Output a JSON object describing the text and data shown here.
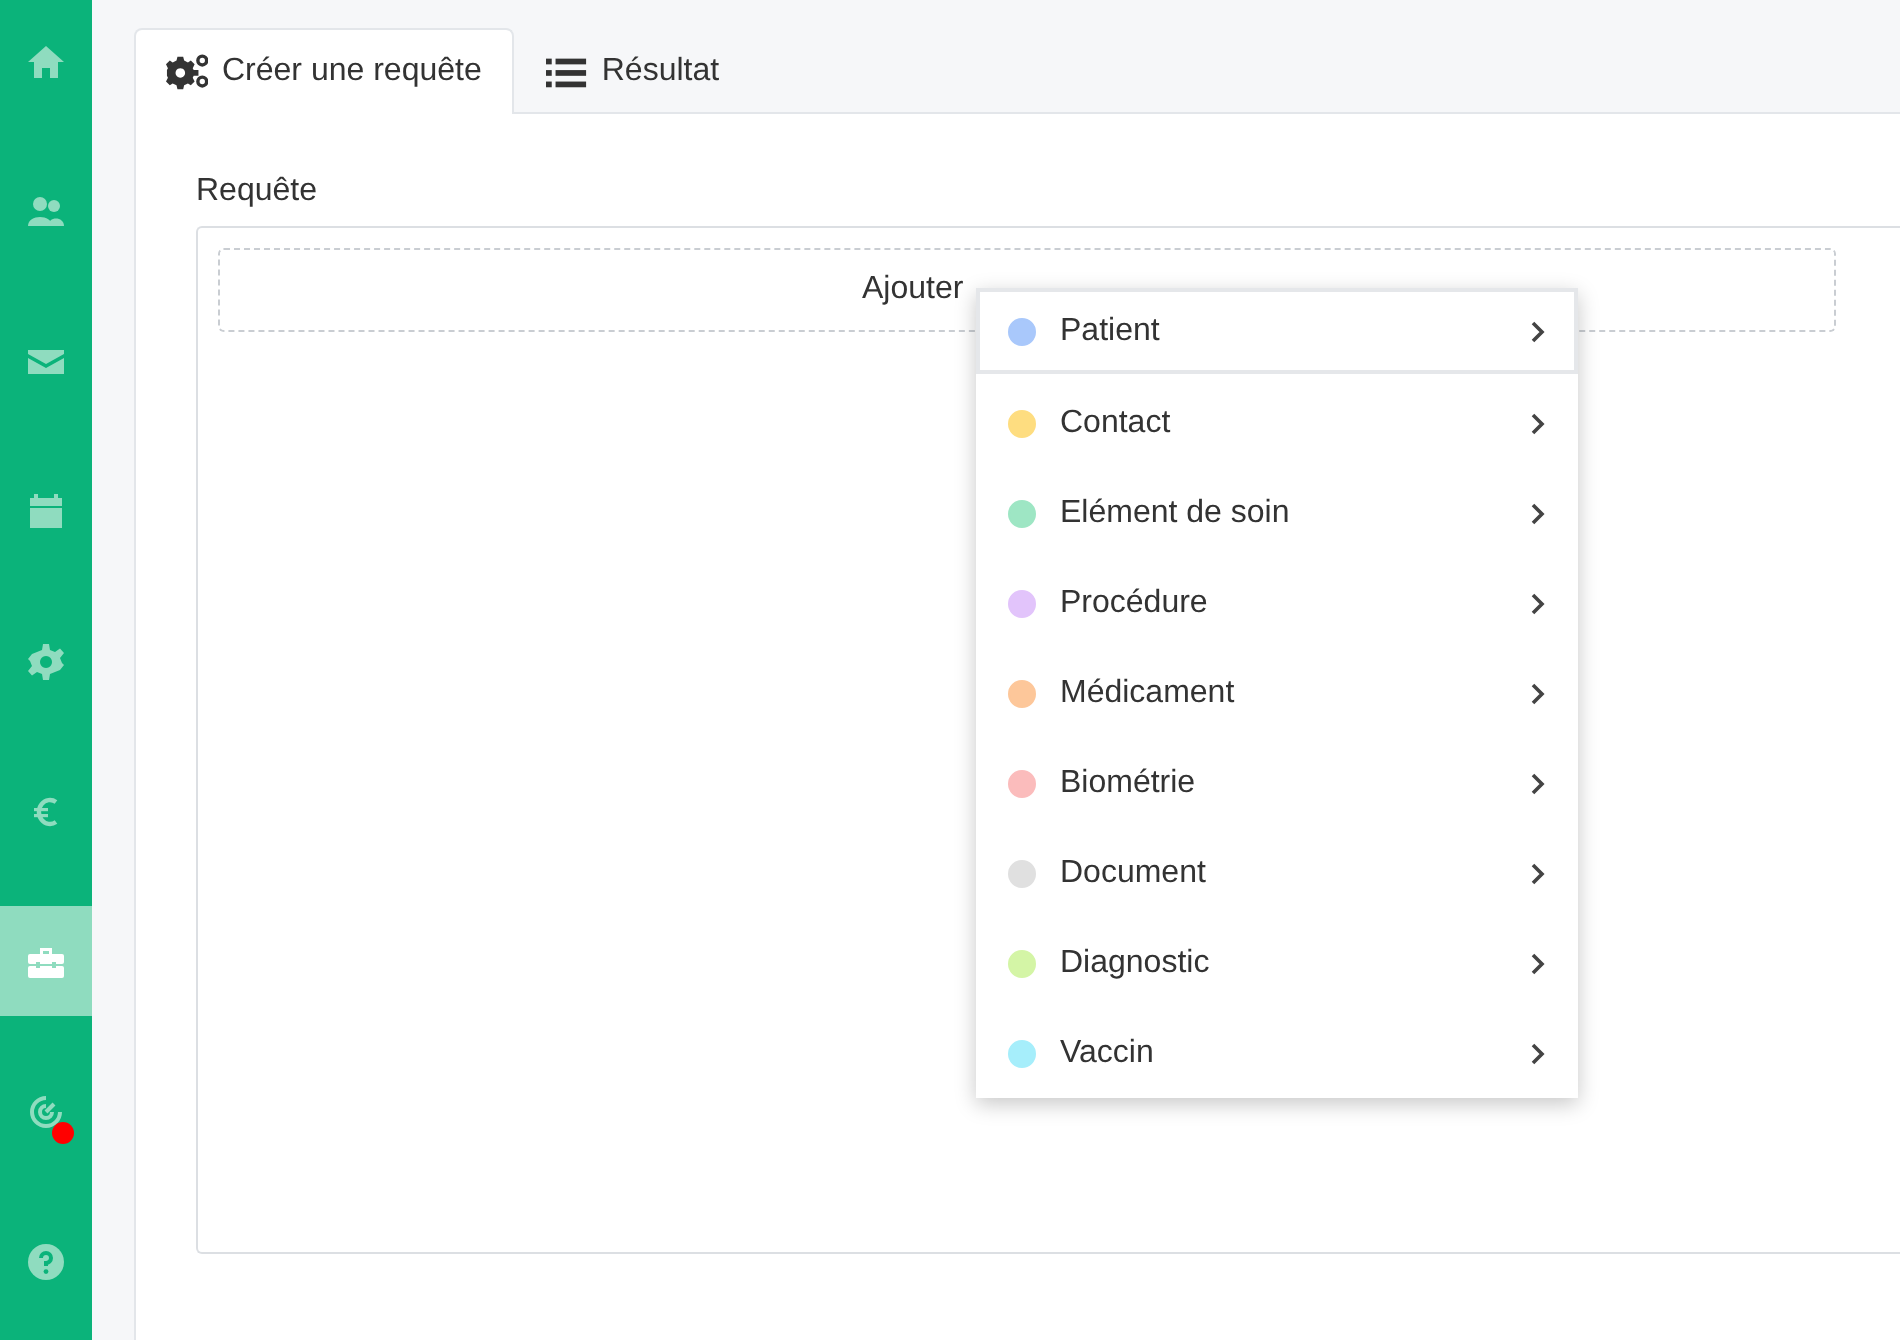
{
  "sidebar": {
    "items": [
      {
        "selected": false,
        "badge": false
      },
      {
        "selected": false,
        "badge": false
      },
      {
        "selected": false,
        "badge": false
      },
      {
        "selected": false,
        "badge": false
      },
      {
        "selected": false,
        "badge": false
      },
      {
        "selected": false,
        "badge": false
      },
      {
        "selected": true,
        "badge": false
      },
      {
        "selected": false,
        "badge": true
      },
      {
        "selected": false,
        "badge": false
      }
    ]
  },
  "tabs": [
    {
      "label": "Créer une requête",
      "selected": true
    },
    {
      "label": "Résultat",
      "selected": false
    }
  ],
  "query": {
    "label": "Requête",
    "add_condition": "Ajouter"
  },
  "menu": {
    "items": [
      {
        "label": "Patient",
        "color": "#a9c8fb",
        "selected": true
      },
      {
        "label": "Contact",
        "color": "#fedd80",
        "selected": false
      },
      {
        "label": "Elément de soin",
        "color": "#9ee6c4",
        "selected": false
      },
      {
        "label": "Procédure",
        "color": "#e2c4fb",
        "selected": false
      },
      {
        "label": "Médicament",
        "color": "#fdc79a",
        "selected": false
      },
      {
        "label": "Biométrie",
        "color": "#fbbcbc",
        "selected": false
      },
      {
        "label": "Document",
        "color": "#e0e0e0",
        "selected": false
      },
      {
        "label": "Diagnostic",
        "color": "#d4f5a6",
        "selected": false
      },
      {
        "label": "Vaccin",
        "color": "#a6eefb",
        "selected": false
      }
    ]
  }
}
